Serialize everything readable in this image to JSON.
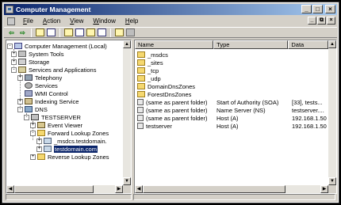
{
  "window": {
    "title": "Computer Management",
    "title_buttons": [
      "_",
      "□",
      "×"
    ]
  },
  "menu": {
    "items": [
      {
        "label": "File",
        "key": "F"
      },
      {
        "label": "Action",
        "key": "A"
      },
      {
        "label": "View",
        "key": "V"
      },
      {
        "label": "Window",
        "key": "W"
      },
      {
        "label": "Help",
        "key": "H"
      }
    ],
    "mdi_buttons": [
      "_",
      "⧉",
      "×"
    ]
  },
  "toolbar": {
    "icons": [
      "back-icon",
      "forward-icon",
      "up-folder-icon",
      "show-tree-icon",
      "refresh-icon",
      "export-icon",
      "properties-icon",
      "help-icon",
      "new-record-icon",
      "delete-record-icon"
    ]
  },
  "tree": {
    "items": [
      {
        "label": "Computer Management (Local)",
        "icon": "computer",
        "expander": "-"
      },
      {
        "label": "System Tools",
        "icon": "tools",
        "expander": "+"
      },
      {
        "label": "Storage",
        "icon": "storage",
        "expander": "+"
      },
      {
        "label": "Services and Applications",
        "icon": "services",
        "expander": "-"
      },
      {
        "label": "Telephony",
        "icon": "phone",
        "expander": "+"
      },
      {
        "label": "Services",
        "icon": "gear",
        "expander": ""
      },
      {
        "label": "WMI Control",
        "icon": "wmi",
        "expander": ""
      },
      {
        "label": "Indexing Service",
        "icon": "index",
        "expander": "+"
      },
      {
        "label": "DNS",
        "icon": "dns",
        "expander": "-"
      },
      {
        "label": "TESTSERVER",
        "icon": "server",
        "expander": "-"
      },
      {
        "label": "Event Viewer",
        "icon": "event",
        "expander": "+"
      },
      {
        "label": "Forward Lookup Zones",
        "icon": "folder",
        "expander": "-"
      },
      {
        "label": "_msdcs.testdomain.",
        "icon": "zone",
        "expander": "+"
      },
      {
        "label": "testdomain.com",
        "icon": "zone",
        "expander": "+",
        "selected": true
      },
      {
        "label": "Reverse Lookup Zones",
        "icon": "folder",
        "expander": "+"
      }
    ]
  },
  "list": {
    "columns": [
      "Name",
      "Type",
      "Data"
    ],
    "rows": [
      {
        "name": "_msdcs",
        "type": "",
        "data": "",
        "icon": "folder"
      },
      {
        "name": "_sites",
        "type": "",
        "data": "",
        "icon": "folder"
      },
      {
        "name": "_tcp",
        "type": "",
        "data": "",
        "icon": "folder"
      },
      {
        "name": "_udp",
        "type": "",
        "data": "",
        "icon": "folder"
      },
      {
        "name": "DomainDnsZones",
        "type": "",
        "data": "",
        "icon": "folder"
      },
      {
        "name": "ForestDnsZones",
        "type": "",
        "data": "",
        "icon": "folder"
      },
      {
        "name": "(same as parent folder)",
        "type": "Start of Authority (SOA)",
        "data": "[33], tests...",
        "icon": "record"
      },
      {
        "name": "(same as parent folder)",
        "type": "Name Server (NS)",
        "data": "testserver....",
        "icon": "record"
      },
      {
        "name": "(same as parent folder)",
        "type": "Host (A)",
        "data": "192.168.1.50",
        "icon": "record"
      },
      {
        "name": "testserver",
        "type": "Host (A)",
        "data": "192.168.1.50",
        "icon": "record"
      }
    ]
  },
  "colors": {
    "title_start": "#0a246a",
    "title_end": "#a6caf0",
    "face": "#d4d0c8",
    "selection": "#0a246a"
  }
}
